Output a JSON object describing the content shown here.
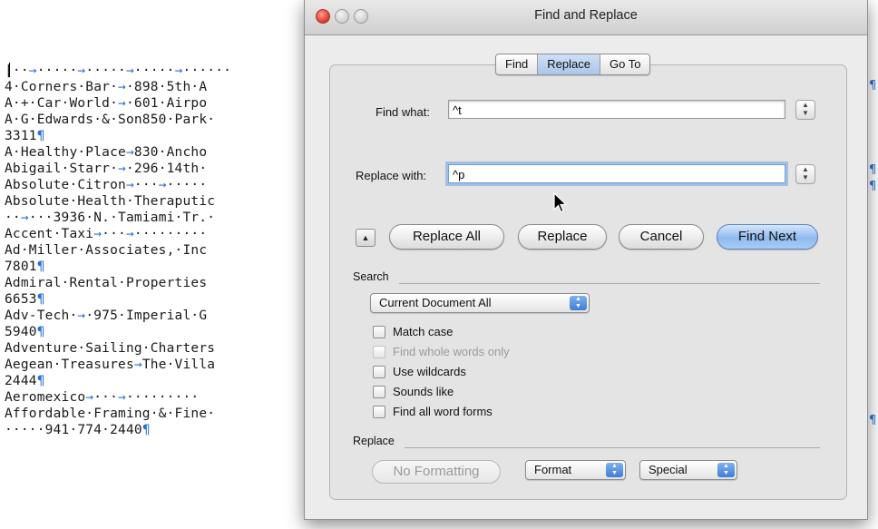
{
  "document": {
    "lines": [
      {
        "text": "4·Corners·Bar·→·898·5th·A"
      },
      {
        "text": "A·+·Car·World·→·601·Airpo"
      },
      {
        "text": "A·G·Edwards·&·Son850·Park·"
      },
      {
        "text": "3311¶"
      },
      {
        "text": "A·Healthy·Place→830·Ancho"
      },
      {
        "text": "Abigail·Starr·→·296·14th·"
      },
      {
        "text": "Absolute·Citron→···→·····"
      },
      {
        "text": "Absolute·Health·Theraputic"
      },
      {
        "text": "··→···3936·N.·Tamiami·Tr.·"
      },
      {
        "text": "Accent·Taxi→···→·········"
      },
      {
        "text": "Ad·Miller·Associates,·Inc"
      },
      {
        "text": "7801¶"
      },
      {
        "text": "Admiral·Rental·Properties"
      },
      {
        "text": "6653¶"
      },
      {
        "text": "Adv-Tech·→·975·Imperial·G"
      },
      {
        "text": "5940¶"
      },
      {
        "text": "Adventure·Sailing·Charters"
      },
      {
        "text": "Aegean·Treasures→The·Villa"
      },
      {
        "text": "2444¶"
      },
      {
        "text": "Aeromexico→···→·········"
      },
      {
        "text": "Affordable·Framing·&·Fine·"
      },
      {
        "text": "·····941·774·2440¶"
      }
    ],
    "top_line": "|··→·····→·····→·····→······"
  },
  "dialog": {
    "title": "Find and Replace",
    "tabs": [
      {
        "label": "Find",
        "active": false
      },
      {
        "label": "Replace",
        "active": true
      },
      {
        "label": "Go To",
        "active": false
      }
    ],
    "find_label": "Find what:",
    "find_value": "^t",
    "replace_label": "Replace with:",
    "replace_value": "^p",
    "buttons": {
      "replace_all": "Replace All",
      "replace": "Replace",
      "cancel": "Cancel",
      "find_next": "Find Next"
    },
    "search_section": "Search",
    "search_scope": "Current Document All",
    "options": [
      {
        "label": "Match case",
        "enabled": true
      },
      {
        "label": "Find whole words only",
        "enabled": false
      },
      {
        "label": "Use wildcards",
        "enabled": true
      },
      {
        "label": "Sounds like",
        "enabled": true
      },
      {
        "label": "Find all word forms",
        "enabled": true
      }
    ],
    "replace_section": "Replace",
    "no_formatting": "No Formatting",
    "format_menu": "Format",
    "special_menu": "Special"
  },
  "colors": {
    "accent": "#8fbaf0",
    "tab_marker": "#2a6fd6",
    "close_button": "#e0443a"
  }
}
